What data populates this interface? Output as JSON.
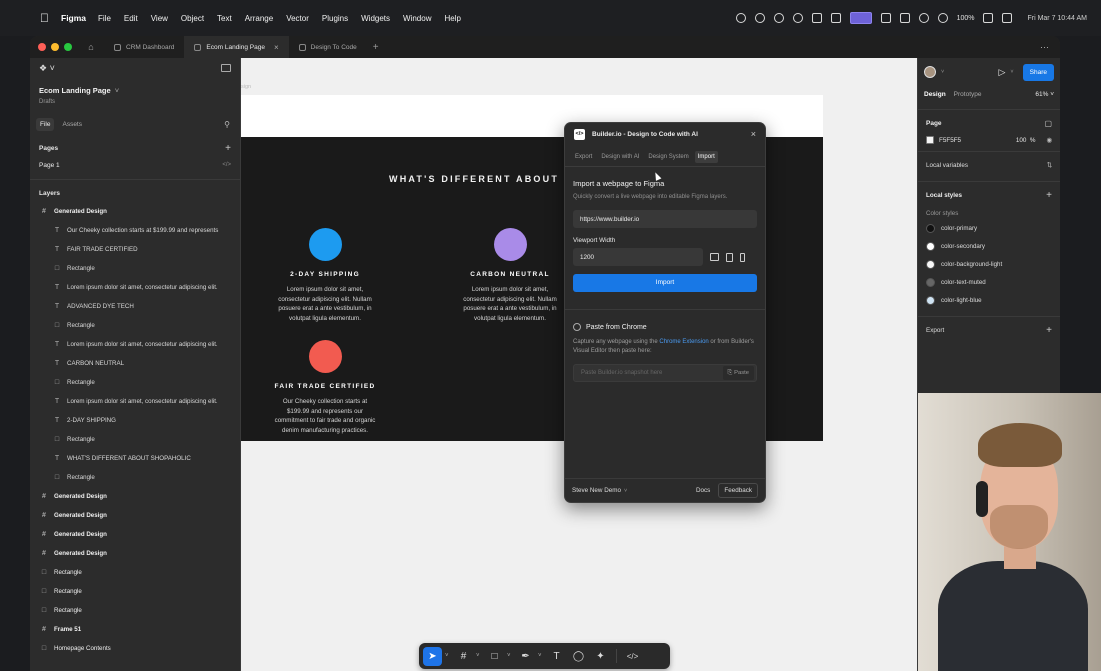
{
  "menubar": {
    "app_name": "Figma",
    "items": [
      "File",
      "Edit",
      "View",
      "Object",
      "Text",
      "Arrange",
      "Vector",
      "Plugins",
      "Widgets",
      "Window",
      "Help"
    ],
    "battery": "100%",
    "datetime": "Fri Mar 7  10:44 AM"
  },
  "tabs": [
    {
      "label": "CRM Dashboard"
    },
    {
      "label": "Ecom Landing Page",
      "active": true
    },
    {
      "label": "Design To Code"
    }
  ],
  "left_panel": {
    "file_name": "Ecom Landing Page",
    "file_location": "Drafts",
    "tab_file": "File",
    "tab_assets": "Assets",
    "pages_heading": "Pages",
    "pages": [
      "Page 1"
    ],
    "layers_heading": "Layers",
    "layers": [
      {
        "icon": "frame",
        "label": "Generated Design",
        "level": "top"
      },
      {
        "icon": "text",
        "label": "Our Cheeky collection starts at $199.99 and represents",
        "level": "child"
      },
      {
        "icon": "text",
        "label": "FAIR TRADE CERTIFIED",
        "level": "child"
      },
      {
        "icon": "rect",
        "label": "Rectangle",
        "level": "child"
      },
      {
        "icon": "text",
        "label": "Lorem ipsum dolor sit amet, consectetur adipiscing elit.",
        "level": "child"
      },
      {
        "icon": "text",
        "label": "ADVANCED DYE TECH",
        "level": "child"
      },
      {
        "icon": "rect",
        "label": "Rectangle",
        "level": "child"
      },
      {
        "icon": "text",
        "label": "Lorem ipsum dolor sit amet, consectetur adipiscing elit.",
        "level": "child"
      },
      {
        "icon": "text",
        "label": "CARBON NEUTRAL",
        "level": "child"
      },
      {
        "icon": "rect",
        "label": "Rectangle",
        "level": "child"
      },
      {
        "icon": "text",
        "label": "Lorem ipsum dolor sit amet, consectetur adipiscing elit.",
        "level": "child"
      },
      {
        "icon": "text",
        "label": "2-DAY SHIPPING",
        "level": "child"
      },
      {
        "icon": "rect",
        "label": "Rectangle",
        "level": "child"
      },
      {
        "icon": "text",
        "label": "WHAT'S DIFFERENT ABOUT SHOPAHOLIC",
        "level": "child"
      },
      {
        "icon": "rect",
        "label": "Rectangle",
        "level": "child"
      },
      {
        "icon": "frame",
        "label": "Generated Design",
        "level": "top"
      },
      {
        "icon": "frame",
        "label": "Generated Design",
        "level": "top"
      },
      {
        "icon": "frame",
        "label": "Generated Design",
        "level": "top"
      },
      {
        "icon": "frame",
        "label": "Generated Design",
        "level": "top"
      },
      {
        "icon": "rect",
        "label": "Rectangle",
        "level": "top-plain"
      },
      {
        "icon": "rect",
        "label": "Rectangle",
        "level": "top-plain"
      },
      {
        "icon": "rect",
        "label": "Rectangle",
        "level": "top-plain"
      },
      {
        "icon": "frame",
        "label": "Frame 51",
        "level": "top"
      },
      {
        "icon": "rect",
        "label": "Homepage Contents",
        "level": "top-plain"
      }
    ]
  },
  "canvas": {
    "label": "sign",
    "heading": "WHAT'S DIFFERENT ABOUT SH",
    "features": [
      {
        "title": "2-DAY SHIPPING",
        "desc": "Lorem ipsum dolor sit amet, consectetur adipiscing elit. Nullam posuere erat a ante vestibulum, in volutpat ligula elementum.",
        "color": "#1d9bf0"
      },
      {
        "title": "CARBON NEUTRAL",
        "desc": "Lorem ipsum dolor sit amet, consectetur adipiscing elit. Nullam posuere erat a ante vestibulum, in volutpat ligula elementum.",
        "color": "#a98be8"
      },
      {
        "title": "FAIR TRADE CERTIFIED",
        "desc": "Our Cheeky collection starts at $199.99 and represents our commitment to fair trade and organic denim manufacturing practices.",
        "color": "#f25b50"
      }
    ]
  },
  "plugin": {
    "title": "Builder.io - Design to Code with AI",
    "tabs": [
      "Export",
      "Design with AI",
      "Design System",
      "Import"
    ],
    "active_tab": "Import",
    "import_title": "Import a webpage to Figma",
    "import_desc": "Quickly convert a live webpage into editable Figma layers.",
    "url_value": "https://www.builder.io",
    "viewport_label": "Viewport Width",
    "viewport_value": "1200",
    "import_button": "Import",
    "chrome_title": "Paste from Chrome",
    "chrome_desc_pre": "Capture any webpage using the ",
    "chrome_link": "Chrome Extension",
    "chrome_desc_post": " or from Builder's Visual Editor then paste here:",
    "paste_placeholder": "Paste Builder.io snapshot here",
    "paste_button": "Paste",
    "account": "Steve New Demo",
    "docs": "Docs",
    "feedback": "Feedback"
  },
  "right_panel": {
    "share": "Share",
    "tab_design": "Design",
    "tab_prototype": "Prototype",
    "zoom": "61%",
    "page_heading": "Page",
    "page_fill": "F5F5F5",
    "page_opacity": "100",
    "page_opacity_unit": "%",
    "local_variables": "Local variables",
    "local_styles": "Local styles",
    "color_styles_label": "Color styles",
    "color_styles": [
      {
        "name": "color-primary",
        "color": "#111111"
      },
      {
        "name": "color-secondary",
        "color": "#ffffff"
      },
      {
        "name": "color-background-light",
        "color": "#f7f7f7"
      },
      {
        "name": "color-text-muted",
        "color": "#666666"
      },
      {
        "name": "color-light-blue",
        "color": "#cfe3f3"
      }
    ],
    "export": "Export"
  },
  "toolbar": {
    "tools": [
      "move-icon",
      "frame-icon",
      "rectangle-icon",
      "pen-icon",
      "text-icon",
      "comment-icon",
      "actions-icon",
      "dev-mode-icon"
    ]
  }
}
